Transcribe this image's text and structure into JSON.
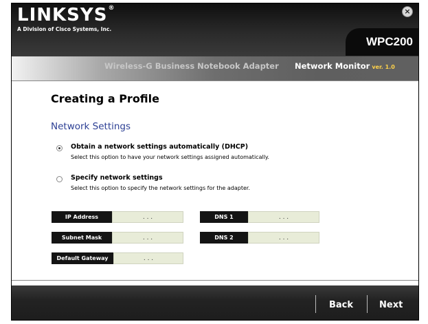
{
  "brand": {
    "name": "LINKSYS",
    "reg": "®",
    "tagline": "A Division of Cisco Systems, Inc."
  },
  "model": "WPC200",
  "close_glyph": "×",
  "header": {
    "product": "Wireless-G Business Notebook Adapter",
    "monitor": "Network Monitor",
    "version": "ver. 1.0"
  },
  "page": {
    "title": "Creating a Profile",
    "section": "Network Settings"
  },
  "options": [
    {
      "label": "Obtain a network settings automatically (DHCP)",
      "desc": "Select this option to have your network settings assigned automatically.",
      "selected": true
    },
    {
      "label": "Specify network settings",
      "desc": "Select this option to specify the network settings for the adapter.",
      "selected": false
    }
  ],
  "fields": {
    "ip_address": {
      "label": "IP Address",
      "value": ". . ."
    },
    "subnet_mask": {
      "label": "Subnet Mask",
      "value": ". . ."
    },
    "default_gateway": {
      "label": "Default Gateway",
      "value": ". . ."
    },
    "dns1": {
      "label": "DNS 1",
      "value": ". . ."
    },
    "dns2": {
      "label": "DNS 2",
      "value": ". . ."
    }
  },
  "buttons": {
    "back": "Back",
    "next": "Next"
  }
}
